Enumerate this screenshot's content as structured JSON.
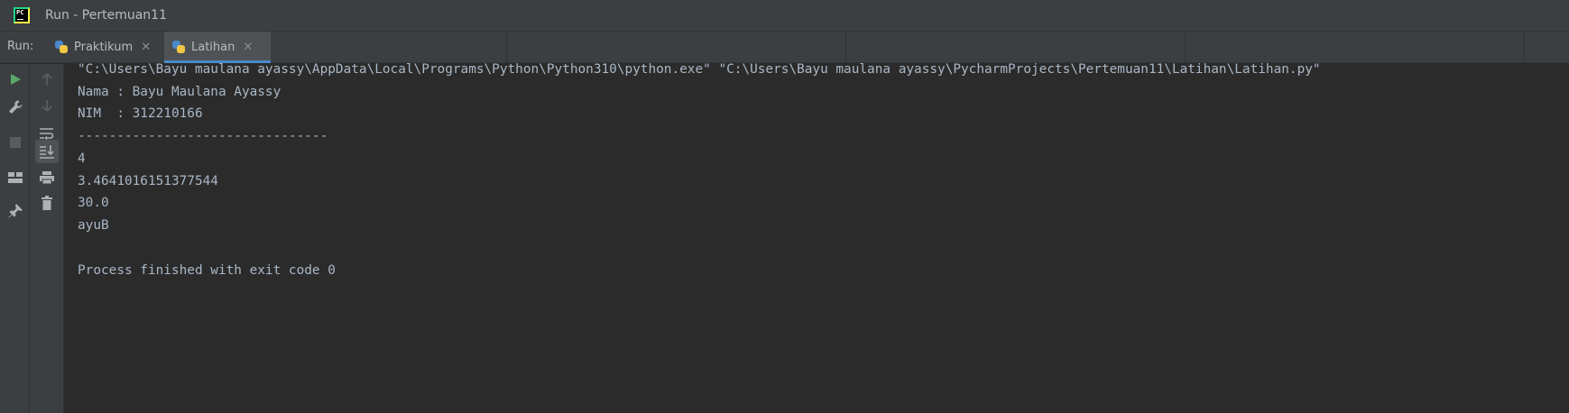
{
  "window": {
    "title": "Run - Pertemuan11"
  },
  "run_panel": {
    "label": "Run:",
    "tabs": [
      {
        "label": "Praktikum",
        "icon": "python-icon",
        "active": false
      },
      {
        "label": "Latihan",
        "icon": "python-icon",
        "active": true
      }
    ],
    "close_glyph": "✕"
  },
  "toolbar": {
    "left": [
      {
        "name": "rerun-icon",
        "color": "#59a869"
      },
      {
        "name": "wrench-icon"
      },
      {
        "name": "stop-icon"
      },
      {
        "name": "layout-icon"
      },
      {
        "name": "pin-icon"
      }
    ],
    "right": [
      {
        "name": "arrow-up-icon"
      },
      {
        "name": "arrow-down-icon"
      },
      {
        "name": "soft-wrap-icon"
      },
      {
        "name": "scroll-to-end-icon",
        "active": true
      },
      {
        "name": "print-icon"
      },
      {
        "name": "trash-icon"
      }
    ]
  },
  "console": {
    "lines": [
      "\"C:\\Users\\Bayu maulana ayassy\\AppData\\Local\\Programs\\Python\\Python310\\python.exe\" \"C:\\Users\\Bayu maulana ayassy\\PycharmProjects\\Pertemuan11\\Latihan\\Latihan.py\"",
      "Nama : Bayu Maulana Ayassy",
      "NIM  : 312210166",
      "--------------------------------",
      "4",
      "3.4641016151377544",
      "30.0",
      "ayuB",
      "",
      "Process finished with exit code 0"
    ]
  },
  "colors": {
    "console_text": "#a9b7c6",
    "panel_bg": "#3c3f41",
    "console_bg": "#2b2b2b",
    "accent": "#4a88c7"
  }
}
